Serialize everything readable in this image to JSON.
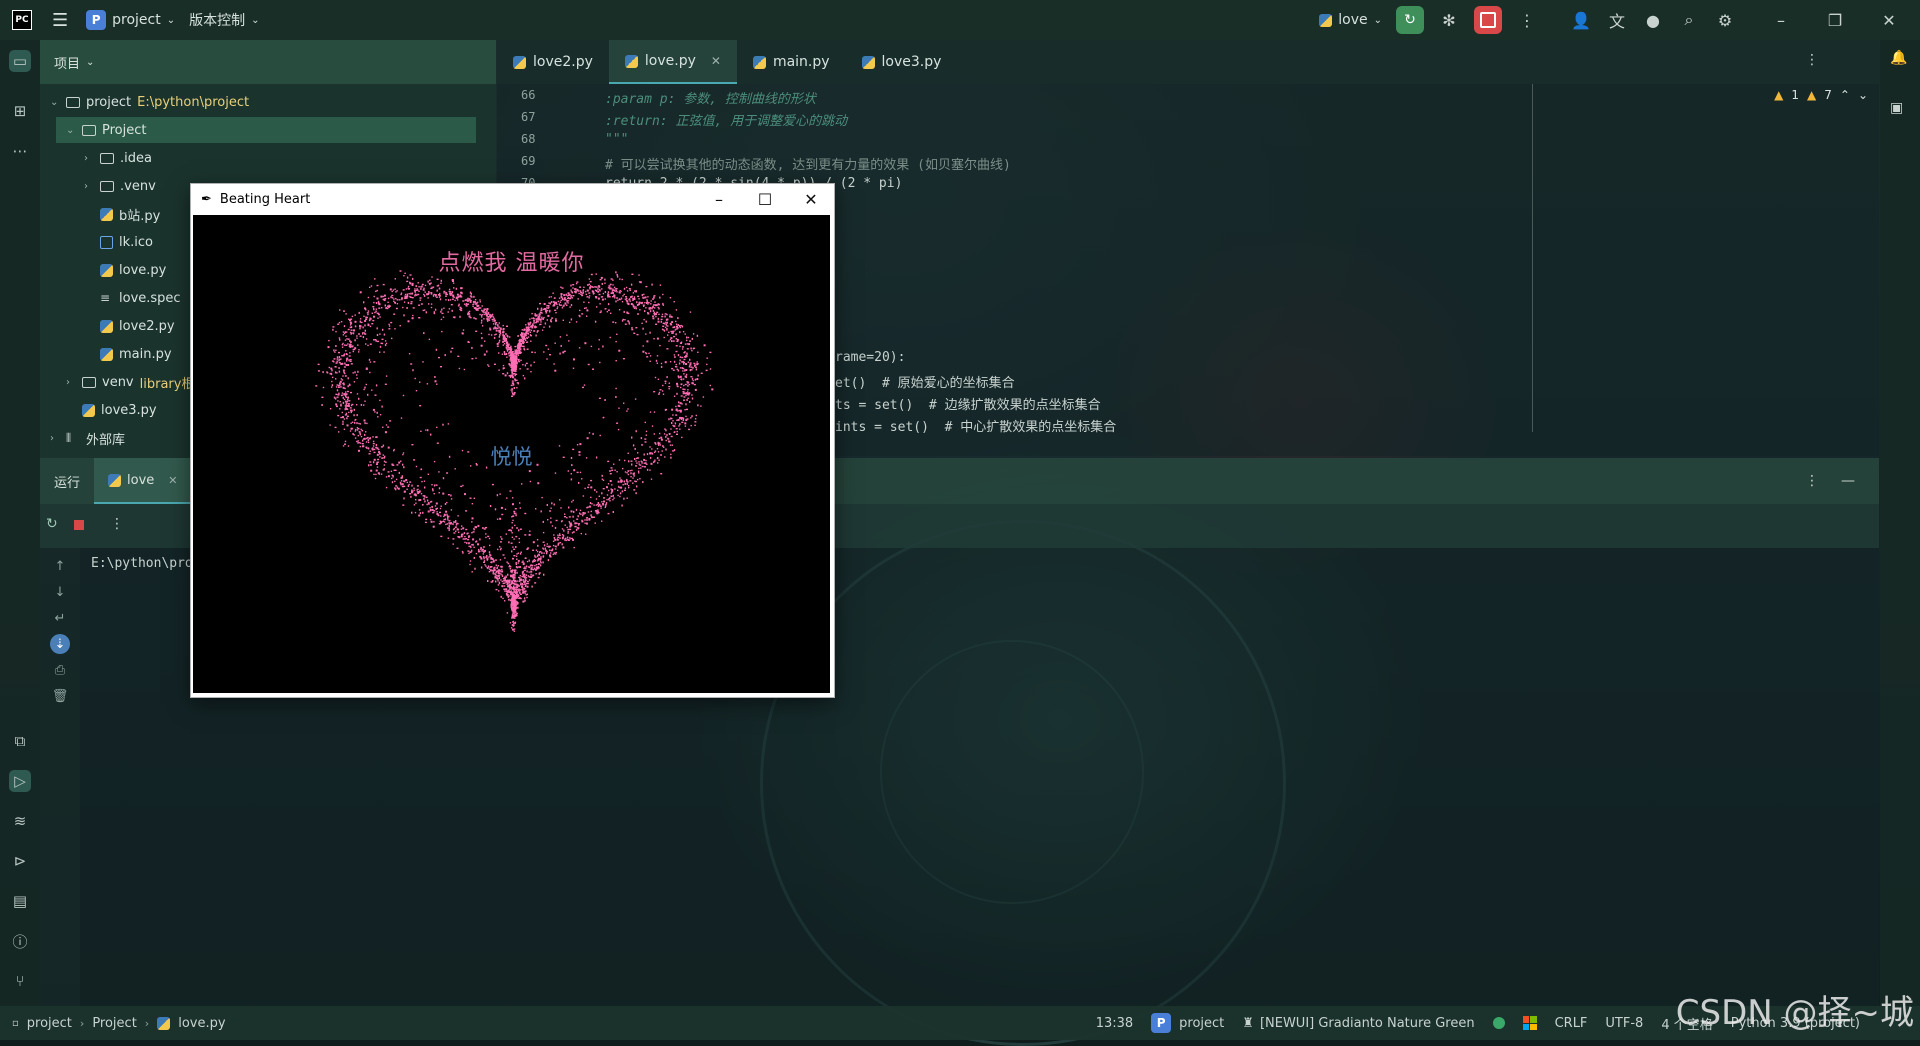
{
  "topbar": {
    "logo": "PC",
    "project_badge": "P",
    "project_name": "project",
    "vcs_menu": "版本控制",
    "run_config": "love"
  },
  "project_panel": {
    "header": "项目",
    "tree": [
      {
        "label": "project",
        "path": "E:\\python\\project",
        "type": "folder",
        "open": true
      },
      {
        "label": "Project",
        "type": "folder",
        "open": true
      },
      {
        "label": ".idea",
        "type": "folder"
      },
      {
        "label": ".venv",
        "type": "folder"
      },
      {
        "label": "b站.py",
        "type": "py"
      },
      {
        "label": "lk.ico",
        "type": "ico"
      },
      {
        "label": "love.py",
        "type": "py"
      },
      {
        "label": "love.spec",
        "type": "spec"
      },
      {
        "label": "love2.py",
        "type": "py"
      },
      {
        "label": "main.py",
        "type": "py"
      },
      {
        "label": "venv",
        "suffix": "library根",
        "type": "folder"
      },
      {
        "label": "love3.py",
        "type": "py"
      },
      {
        "label": "外部库",
        "type": "lib"
      }
    ]
  },
  "editor": {
    "tabs": [
      {
        "label": "love2.py"
      },
      {
        "label": "love.py",
        "active": true
      },
      {
        "label": "main.py"
      },
      {
        "label": "love3.py"
      }
    ],
    "line_numbers": [
      "66",
      "67",
      "68",
      "69",
      "70"
    ],
    "lines": [
      ":param p: 参数, 控制曲线的形状",
      ":return: 正弦值, 用于调整爱心的跳动",
      "\"\"\"",
      "# 可以尝试换其他的动态函数, 达到更有力量的效果 (如贝塞尔曲线)",
      "return 2 * (2 * sin(4 * p)) / (2 * pi)"
    ],
    "partial_lines": [
      "rame=20):",
      "et()  # 原始爱心的坐标集合",
      "ts = set()  # 边缘扩散效果的点坐标集合",
      "ints = set()  # 中心扩散效果的点坐标集合"
    ],
    "inspections": {
      "warnings": "1",
      "weak": "7"
    }
  },
  "run_panel": {
    "tab_run": "运行",
    "tab_config": "love",
    "console": "E:\\python\\pro"
  },
  "heart_window": {
    "title": "Beating Heart",
    "headline": "点燃我 温暖你",
    "name": "悦悦",
    "heart_color": "#ff6eb4"
  },
  "statusbar": {
    "breadcrumb": [
      "project",
      "Project",
      "love.py"
    ],
    "time": "13:38",
    "interpreter_badge": "P",
    "project": "project",
    "theme": "[NEWUI] Gradianto Nature Green",
    "line_sep": "CRLF",
    "encoding": "UTF-8",
    "indent": "4 个空格",
    "python": "Python 3.9 (project)"
  },
  "watermark": "CSDN @择~城"
}
